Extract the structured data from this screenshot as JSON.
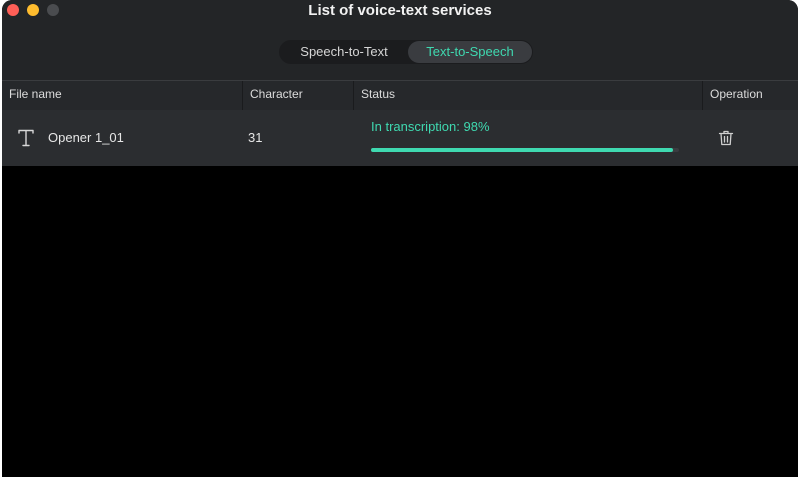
{
  "window": {
    "title": "List of voice-text services"
  },
  "tabs": [
    {
      "label": "Speech-to-Text",
      "selected": false
    },
    {
      "label": "Text-to-Speech",
      "selected": true
    }
  ],
  "table": {
    "columns": [
      "File name",
      "Character",
      "Status",
      "Operation"
    ],
    "rows": [
      {
        "type_icon": "text-type-icon",
        "file_name": "Opener 1_01",
        "character": "31",
        "status": "In transcription: 98%",
        "progress_fraction": 0.98,
        "operation_icon": "trash-icon"
      }
    ]
  },
  "colors": {
    "accent": "#3fd9b0",
    "titlebar": "#232527",
    "header": "#26282b",
    "row": "#2b2d30",
    "content_bg": "#000000",
    "close": "#ff5f57",
    "minimize": "#febc2e"
  }
}
